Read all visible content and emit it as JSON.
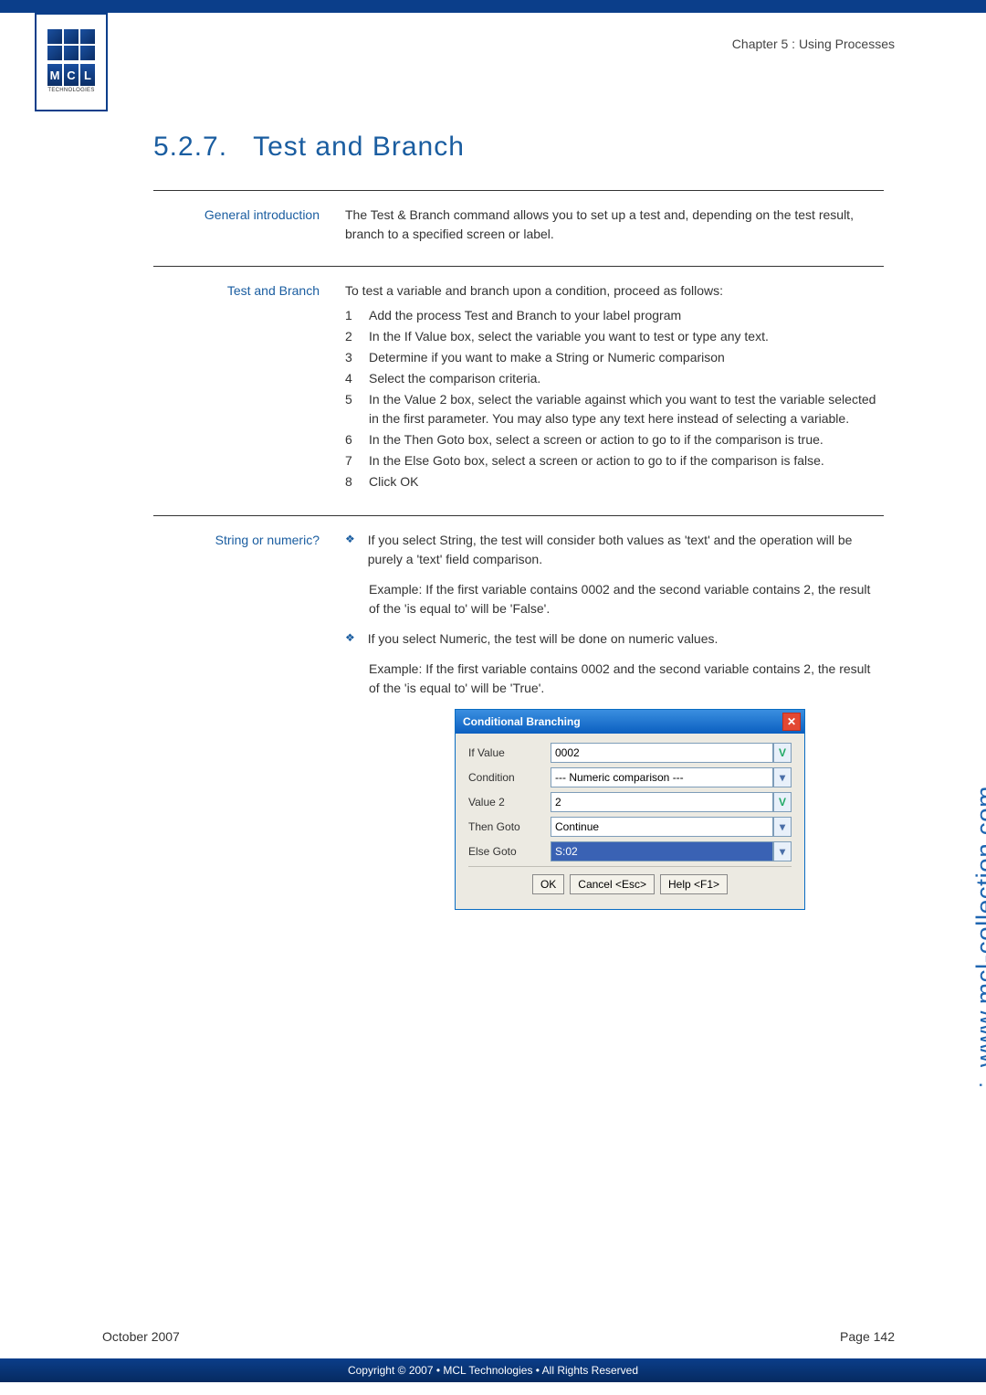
{
  "chapter_header": "Chapter 5 : Using Processes",
  "logo": {
    "tech_label": "TECHNOLOGIES",
    "letters": [
      "M",
      "C",
      "L"
    ]
  },
  "section": {
    "number": "5.2.7.",
    "title": "Test and Branch"
  },
  "blocks": {
    "intro": {
      "label": "General introduction",
      "text": "The Test & Branch command allows you to set up a test and, depending on the test result, branch to a specified screen or label."
    },
    "steps": {
      "label": "Test and Branch",
      "lead": "To test a variable and branch upon a condition, proceed as follows:",
      "items": [
        "Add the process Test and Branch to your label program",
        "In the If Value box, select the variable you want to test or type any text.",
        "Determine if you want to make a String or Numeric comparison",
        "Select the comparison criteria.",
        "In the Value 2 box, select the variable against which you want to test the variable selected in the first parameter. You may also type any text here instead of selecting a variable.",
        "In the Then Goto box, select a screen or action to go to if the comparison is true.",
        "In the Else Goto box, select a screen or action to go to if the comparison is false.",
        "Click OK"
      ]
    },
    "string_numeric": {
      "label": "String or numeric?",
      "bullet1": "If you select String, the test will consider both values as 'text' and the operation will be purely a 'text' field comparison.",
      "example1": "Example: If the first variable contains 0002 and the second variable contains 2, the result of the 'is equal to' will be 'False'.",
      "bullet2": "If you select Numeric, the test will be done on numeric values.",
      "example2": "Example: If the first variable contains 0002 and the second variable contains 2, the result of the 'is equal to' will be 'True'."
    }
  },
  "dialog": {
    "title": "Conditional Branching",
    "rows": {
      "if_value": {
        "label": "If Value",
        "value": "0002",
        "btn": "V"
      },
      "condition": {
        "label": "Condition",
        "value": "--- Numeric comparison ---",
        "btn": "▾"
      },
      "value2": {
        "label": "Value 2",
        "value": "2",
        "btn": "V"
      },
      "then_goto": {
        "label": "Then Goto",
        "value": "Continue",
        "btn": "▾"
      },
      "else_goto": {
        "label": "Else Goto",
        "value": "S:02",
        "btn": "▾"
      }
    },
    "buttons": {
      "ok": "OK",
      "cancel": "Cancel <Esc>",
      "help": "Help <F1>"
    }
  },
  "side_url": "www.mcl-collection.com",
  "footer": {
    "date": "October 2007",
    "page": "Page 142"
  },
  "copyright": "Copyright © 2007 • MCL Technologies • All Rights Reserved"
}
